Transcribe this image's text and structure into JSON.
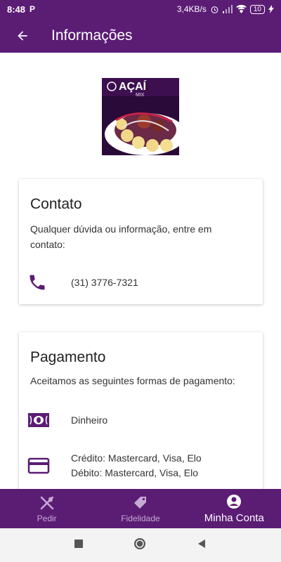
{
  "status_bar": {
    "time": "8:48",
    "app_icon": "P",
    "speed": "3,4KB/s",
    "battery": "10"
  },
  "app_bar": {
    "title": "Informações"
  },
  "logo": {
    "brand": "AÇAÍ",
    "brand_sub": "MIX"
  },
  "contact": {
    "title": "Contato",
    "description": "Qualquer dúvida ou informação, entre em contato:",
    "phone": "(31) 3776-7321"
  },
  "payment": {
    "title": "Pagamento",
    "description": "Aceitamos as seguintes formas de pagamento:",
    "cash": "Dinheiro",
    "credit": "Crédito: Mastercard, Visa, Elo",
    "debit": "Débito: Mastercard, Visa, Elo"
  },
  "bottom_nav": {
    "items": [
      {
        "label": "Pedir",
        "icon": "fork-knife-icon"
      },
      {
        "label": "Fidelidade",
        "icon": "tag-icon"
      },
      {
        "label": "Minha Conta",
        "icon": "account-circle-icon"
      }
    ],
    "active_index": 2
  },
  "colors": {
    "primary": "#5b1c74",
    "inactive_nav": "#c7a9d3"
  }
}
